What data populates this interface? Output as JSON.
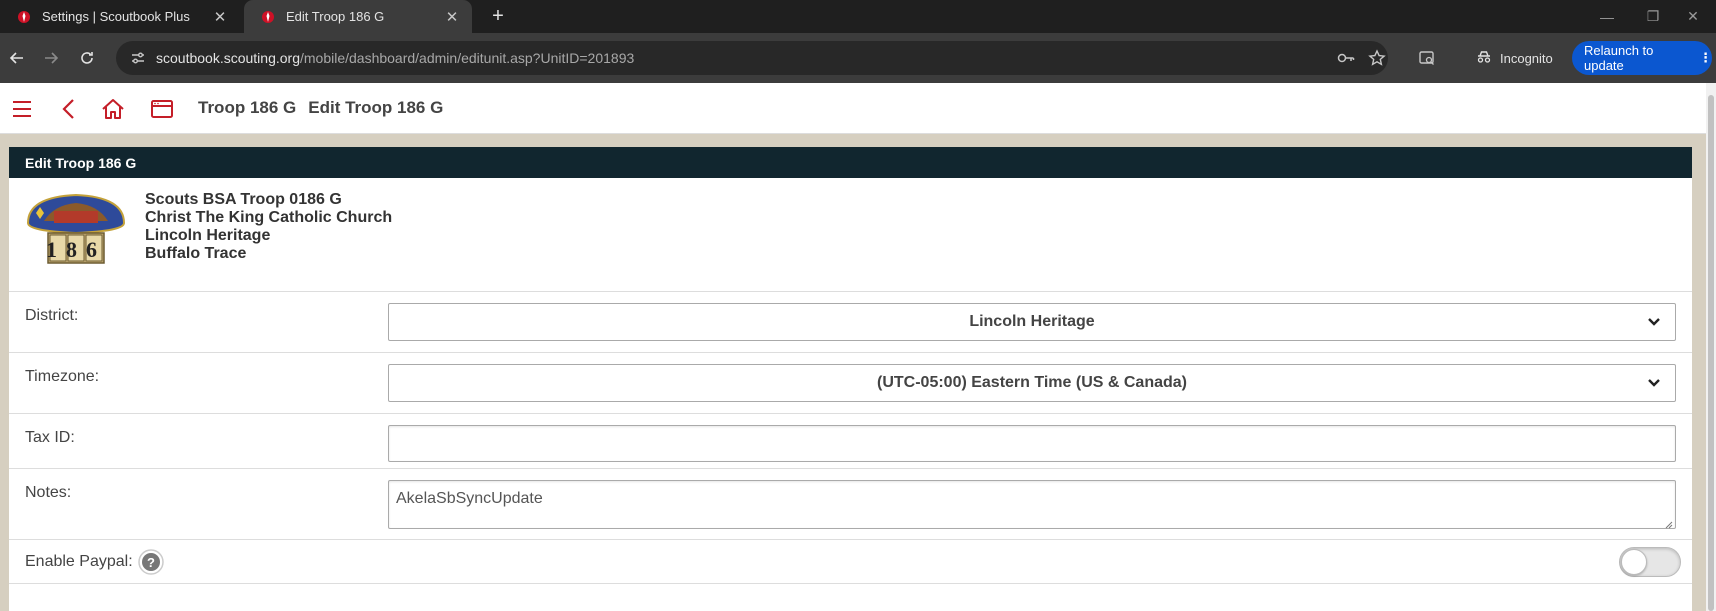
{
  "browser": {
    "tabs": [
      {
        "title": "Settings | Scoutbook Plus",
        "active": false
      },
      {
        "title": "Edit Troop 186 G",
        "active": true
      }
    ],
    "url_host": "scoutbook.scouting.org",
    "url_path": "/mobile/dashboard/admin/editunit.asp?UnitID=201893",
    "incognito_label": "Incognito",
    "relaunch_label": "Relaunch to update"
  },
  "header": {
    "unit_name": "Troop 186 G",
    "page_title": "Edit Troop 186 G",
    "accent_color": "#c41e28"
  },
  "card": {
    "title": "Edit Troop 186 G",
    "unit_lines": [
      "Scouts BSA Troop 0186 G",
      "Christ The King Catholic Church",
      "Lincoln Heritage",
      "Buffalo Trace"
    ],
    "logo_number": "186",
    "header_color": "#11262f"
  },
  "form": {
    "district": {
      "label": "District:",
      "value": "Lincoln Heritage"
    },
    "timezone": {
      "label": "Timezone:",
      "value": "(UTC-05:00) Eastern Time (US & Canada)"
    },
    "tax_id": {
      "label": "Tax ID:",
      "value": ""
    },
    "notes": {
      "label": "Notes:",
      "value": "AkelaSbSyncUpdate"
    },
    "paypal": {
      "label": "Enable Paypal:",
      "enabled": false
    }
  }
}
